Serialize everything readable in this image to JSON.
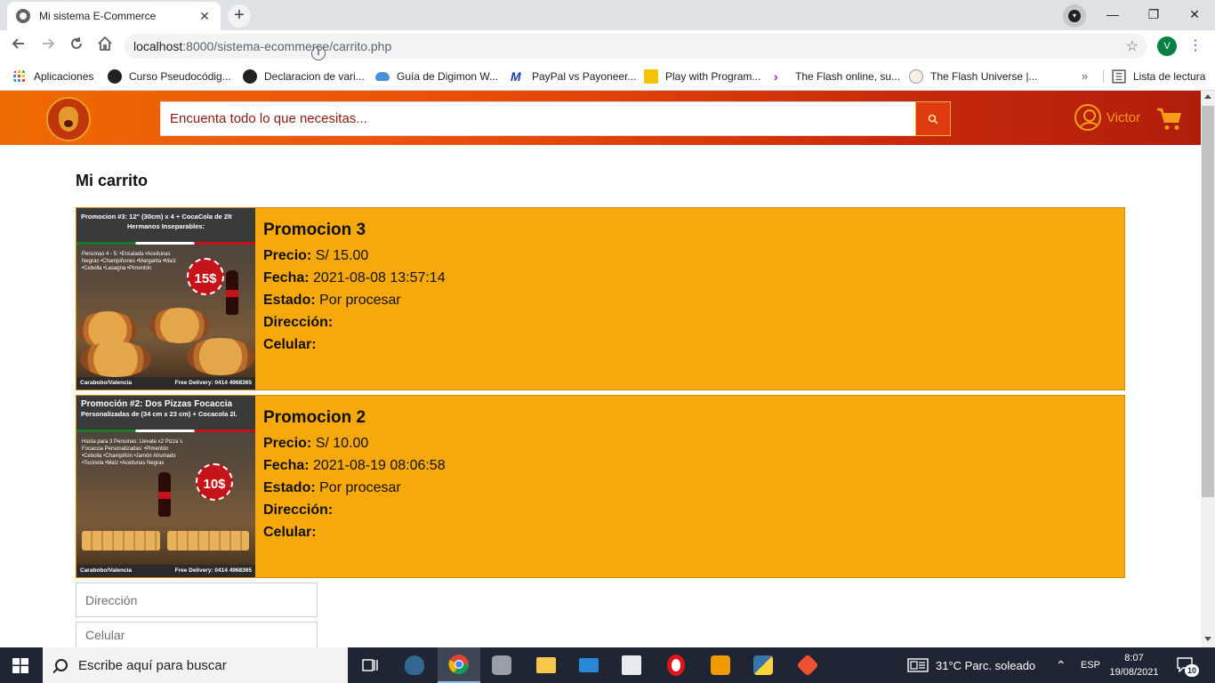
{
  "browser": {
    "tab_title": "Mi sistema E-Commerce",
    "tab_close": "✕",
    "new_tab": "+",
    "window_min": "—",
    "window_max": "❐",
    "window_close": "✕",
    "url_host": "localhost",
    "url_path": ":8000/sistema-ecommerce/carrito.php",
    "profile_initial": "V",
    "bookmarks": [
      {
        "label": "Aplicaciones",
        "icon": "apps-grid-icon",
        "color": "#e94235"
      },
      {
        "label": "Curso Pseudocódig...",
        "icon": "github-icon",
        "color": "#222222"
      },
      {
        "label": "Declaracion de vari...",
        "icon": "github-icon",
        "color": "#222222"
      },
      {
        "label": "Guía de Digimon W...",
        "icon": "cloud-icon",
        "color": "#4a90d9"
      },
      {
        "label": "PayPal vs Payoneer...",
        "icon": "m-logo-icon",
        "color": "#1a3fb0"
      },
      {
        "label": "Play with Program...",
        "icon": "pencil-icon",
        "color": "#f5c400"
      },
      {
        "label": "The Flash online, su...",
        "icon": "arrow-icon",
        "color": "#7b2fbf"
      },
      {
        "label": "The Flash Universe |...",
        "icon": "compass-icon",
        "color": "#d4a017"
      }
    ],
    "bookmarks_more": "»",
    "reading_list": "Lista de lectura"
  },
  "header": {
    "search_placeholder": "Encuenta todo lo que necesitas...",
    "user_name": "Victor"
  },
  "page": {
    "title": "Mi carrito",
    "labels": {
      "price": "Precio:",
      "date": "Fecha:",
      "status": "Estado:",
      "address": "Dirección:",
      "phone": "Celular:"
    },
    "items": [
      {
        "name": "Promocion 3",
        "price": "S/ 15.00",
        "date": "2021-08-08 13:57:14",
        "status": "Por procesar",
        "address": "",
        "phone": "",
        "image": {
          "heading": "Promocion #3: 12\" (30cm) x 4 + CocaCola de 2lt",
          "subheading": "Hermanos Inseparables:",
          "body": "Personas 4 - 5: •Ensalada •Aceitunas Negras •Champiñones •Margarita •Maíz •Cebolla •Lasagna •Pimentón",
          "badge": "15$",
          "footer_left": "Carabobo/Valencia",
          "footer_right": "Free Delivery: 0414 4968365"
        }
      },
      {
        "name": "Promocion 2",
        "price": "S/ 10.00",
        "date": "2021-08-19 08:06:58",
        "status": "Por procesar",
        "address": "",
        "phone": "",
        "image": {
          "heading": "Promoción #2: Dos Pizzas Focaccia",
          "subheading": "Personalizadas de (34 cm x 23 cm) + Cocacola 2l.",
          "body": "Hasta para 3 Personas: Llevate x2 Pizza´s Focaccia Personalizadas: •Pimentón •Cebolla •Champiñón •Jamón Ahumado •Tocineta •Maíz •Aceitunas Negras",
          "badge": "10$",
          "footer_left": "Carabobo/Valencia",
          "footer_right": "Free Delivery: 0414 4968365"
        }
      }
    ],
    "address_placeholder": "Dirección",
    "phone_placeholder": "Celular"
  },
  "taskbar": {
    "search_placeholder": "Escribe aquí para buscar",
    "weather": "31°C  Parc. soleado",
    "language": "ESP",
    "time": "8:07",
    "date": "19/08/2021",
    "notifications": "10"
  },
  "colors": {
    "card_bg": "#f7a90b",
    "header_start": "#f06b05",
    "header_end": "#b01d0c",
    "accent_user": "#f59d18"
  }
}
